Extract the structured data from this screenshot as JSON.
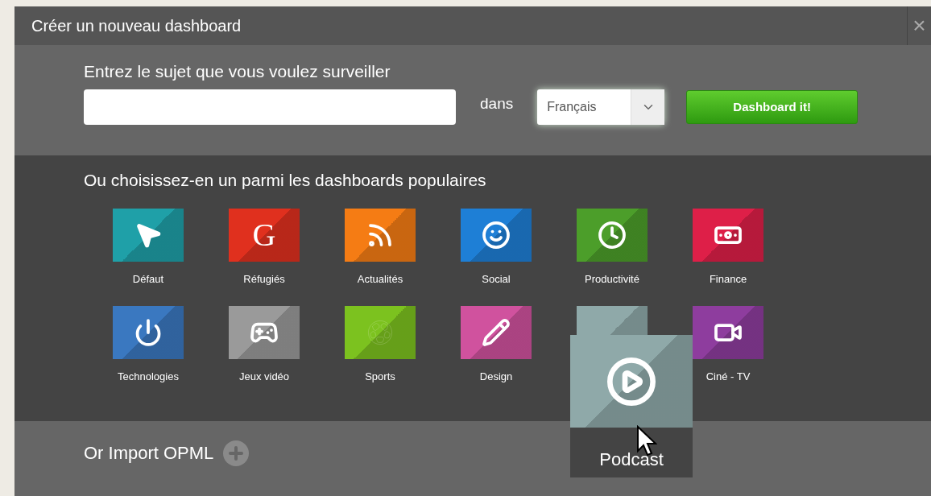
{
  "dialog": {
    "title": "Créer un nouveau dashboard",
    "close": "×"
  },
  "topic": {
    "label": "Entrez le sujet que vous voulez surveiller",
    "in_label": "dans",
    "language": "Français",
    "submit": "Dashboard it!"
  },
  "popular": {
    "heading": "Ou choisissez-en un parmi les dashboards populaires",
    "tiles": [
      {
        "label": "Défaut",
        "color": "#1fa0a8",
        "hovered": false
      },
      {
        "label": "Réfugiés",
        "color": "#e0301e",
        "glyph": "G",
        "hovered": false
      },
      {
        "label": "Actualités",
        "color": "#f57c14",
        "hovered": false
      },
      {
        "label": "Social",
        "color": "#1e7fd6",
        "hovered": false
      },
      {
        "label": "Productivité",
        "color": "#4c9e2a",
        "hovered": false
      },
      {
        "label": "Finance",
        "color": "#de1f48",
        "hovered": false
      },
      {
        "label": "Technologies",
        "color": "#3a78c0",
        "hovered": false
      },
      {
        "label": "Jeux vidéo",
        "color": "#9a9a9a",
        "hovered": false
      },
      {
        "label": "Sports",
        "color": "#7cc21f",
        "hovered": false
      },
      {
        "label": "Design",
        "color": "#d0529e",
        "hovered": false
      },
      {
        "label": "Podcast",
        "color": "#8fa9a9",
        "hovered": true
      },
      {
        "label": "Ciné - TV",
        "color": "#8e3d9e",
        "hovered": false
      }
    ]
  },
  "import": {
    "label": "Or Import OPML"
  }
}
